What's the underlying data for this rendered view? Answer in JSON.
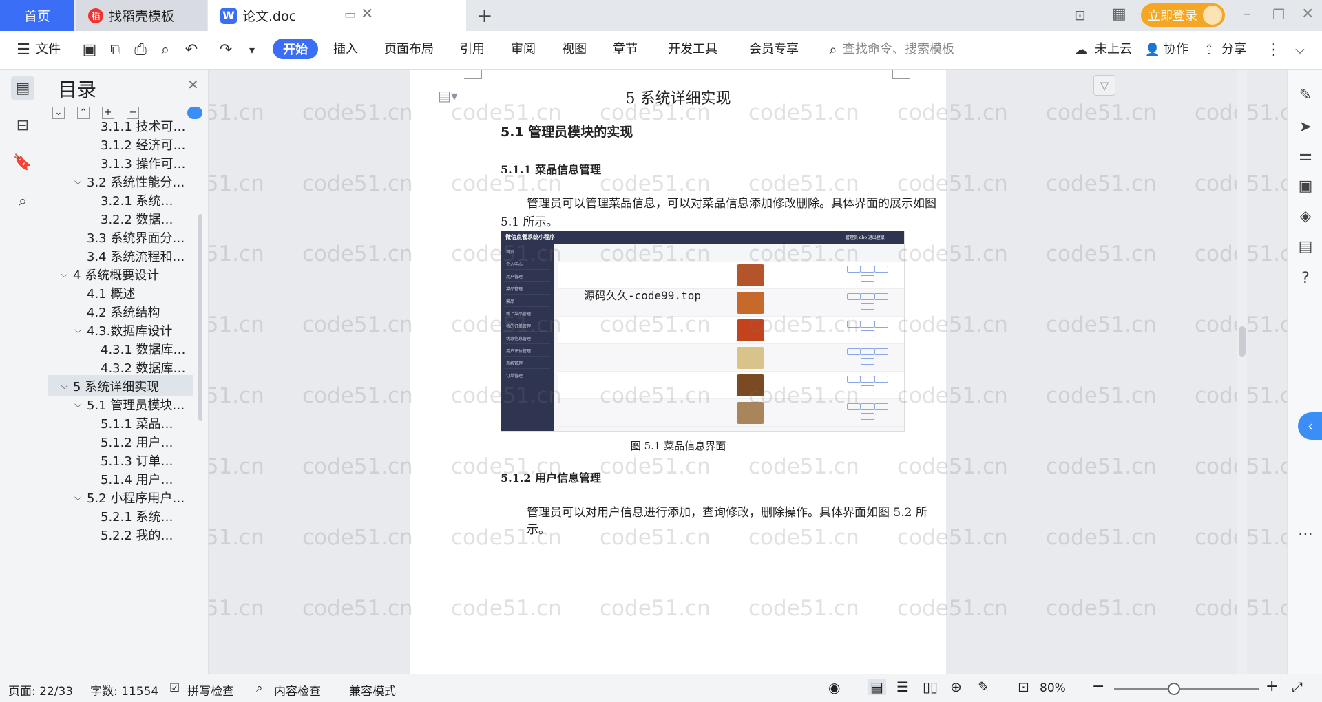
{
  "tabs": {
    "home": "首页",
    "template": "找稻壳模板",
    "doc": "论文.doc"
  },
  "login": "立即登录",
  "ribbon": {
    "file": "文件",
    "tabs": [
      "开始",
      "插入",
      "页面布局",
      "引用",
      "审阅",
      "视图",
      "章节",
      "开发工具",
      "会员专享"
    ],
    "search_placeholder": "查找命令、搜索模板",
    "cloud": "未上云",
    "collab": "协作",
    "share": "分享"
  },
  "toc": {
    "title": "目录",
    "items": [
      {
        "label": "3.1.1 技术可…",
        "level": 3
      },
      {
        "label": "3.1.2 经济可…",
        "level": 3
      },
      {
        "label": "3.1.3 操作可…",
        "level": 3
      },
      {
        "label": "3.2 系统性能分…",
        "level": 2,
        "expanded": true
      },
      {
        "label": "3.2.1  系统…",
        "level": 3
      },
      {
        "label": "3.2.2  数据…",
        "level": 3
      },
      {
        "label": "3.3 系统界面分…",
        "level": 2
      },
      {
        "label": "3.4 系统流程和…",
        "level": 2
      },
      {
        "label": "4 系统概要设计",
        "level": 1,
        "expanded": true
      },
      {
        "label": "4.1 概述",
        "level": 2
      },
      {
        "label": "4.2 系统结构",
        "level": 2
      },
      {
        "label": "4.3.数据库设计",
        "level": 2,
        "expanded": true
      },
      {
        "label": "4.3.1 数据库…",
        "level": 3
      },
      {
        "label": "4.3.2 数据库…",
        "level": 3
      },
      {
        "label": "5 系统详细实现",
        "level": 1,
        "expanded": true,
        "active": true
      },
      {
        "label": "5.1  管理员模块…",
        "level": 2,
        "expanded": true
      },
      {
        "label": "5.1.1  菜品…",
        "level": 3
      },
      {
        "label": "5.1.2  用户…",
        "level": 3
      },
      {
        "label": "5.1.3  订单…",
        "level": 3
      },
      {
        "label": "5.1.4  用户…",
        "level": 3
      },
      {
        "label": "5.2  小程序用户…",
        "level": 2,
        "expanded": true
      },
      {
        "label": "5.2.1  系统…",
        "level": 3
      },
      {
        "label": "5.2.2  我的…",
        "level": 3
      }
    ]
  },
  "doc": {
    "chapter": "5 系统详细实现",
    "h2": "5.1  管理员模块的实现",
    "h3a": "5.1.1  菜品信息管理",
    "p1a": "管理员可以管理菜品信息，可以对菜品信息添加修改删除。具体界面的展示如图",
    "p1b": "5.1 所示。",
    "caption": "图 5.1  菜品信息界面",
    "h3b": "5.1.2  用户信息管理",
    "p2": "管理员可以对用户信息进行添加，查询修改，删除操作。具体界面如图 5.2 所示。",
    "overlay": "源码久久-code99.top",
    "shot_title": "微信点餐系统小程序",
    "shot_user": "管理员 abo  退出登录",
    "shot_menu": [
      "首页",
      "个人中心",
      "用户管理",
      "菜品管理",
      "菜品",
      "新上菜品管理",
      "我的订单管理",
      "优惠信息管理",
      "用户评价管理",
      "系统管理",
      "订单管理"
    ],
    "watermark": "code51.cn"
  },
  "status": {
    "page": "页面: 22/33",
    "words": "字数: 11554",
    "spell": "拼写检查",
    "content": "内容检查",
    "compat": "兼容模式",
    "zoom": "80%"
  }
}
